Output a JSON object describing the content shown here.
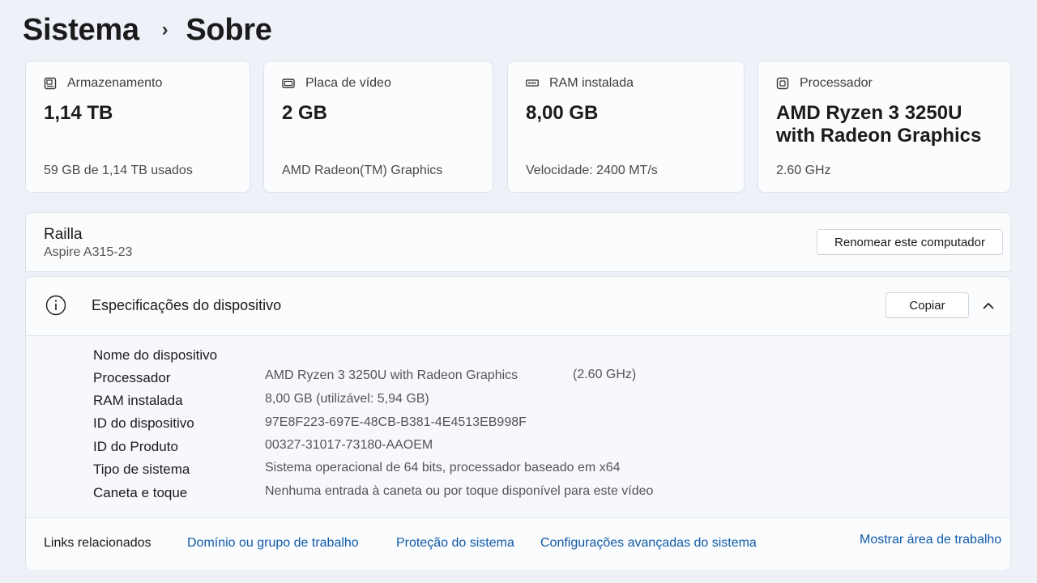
{
  "breadcrumb": {
    "parent": "Sistema",
    "separator": "›",
    "current": "Sobre"
  },
  "cards": [
    {
      "icon": "storage-icon",
      "label": "Armazenamento",
      "value": "1,14 TB",
      "sub": "59 GB de 1,14 TB usados"
    },
    {
      "icon": "gpu-icon",
      "label": "Placa de vídeo",
      "value": "2 GB",
      "sub": "AMD Radeon(TM) Graphics"
    },
    {
      "icon": "ram-icon",
      "label": "RAM instalada",
      "value": "8,00 GB",
      "sub": "Velocidade: 2400 MT/s"
    },
    {
      "icon": "cpu-icon",
      "label": "Processador",
      "value_line1": "AMD Ryzen 3 3250U",
      "value_line2": "with Radeon Graphics",
      "sub": "2.60 GHz"
    }
  ],
  "device": {
    "name": "Railla",
    "model": "Aspire A315-23",
    "rename_label": "Renomear este computador"
  },
  "specs": {
    "title": "Especificações do dispositivo",
    "copy_label": "Copiar",
    "rows": [
      {
        "label": "Nome do dispositivo",
        "value": ""
      },
      {
        "label": "Processador",
        "value": "AMD Ryzen 3 3250U with Radeon Graphics",
        "extra": "(2.60 GHz)"
      },
      {
        "label": "RAM instalada",
        "value": "8,00 GB (utilizável: 5,94 GB)"
      },
      {
        "label": "ID do dispositivo",
        "value": "97E8F223-697E-48CB-B381-4E4513EB998F"
      },
      {
        "label": "ID do Produto",
        "value": "00327-31017-73180-AAOEM"
      },
      {
        "label": "Tipo de sistema",
        "value": "Sistema operacional de 64 bits, processador baseado em x64"
      },
      {
        "label": "Caneta e toque",
        "value": "Nenhuma entrada à caneta ou por toque disponível para este vídeo"
      }
    ]
  },
  "related": {
    "title": "Links relacionados",
    "links": [
      "Domínio ou grupo de trabalho",
      "Proteção do sistema",
      "Configurações avançadas do sistema",
      "Mostrar área de trabalho"
    ]
  }
}
